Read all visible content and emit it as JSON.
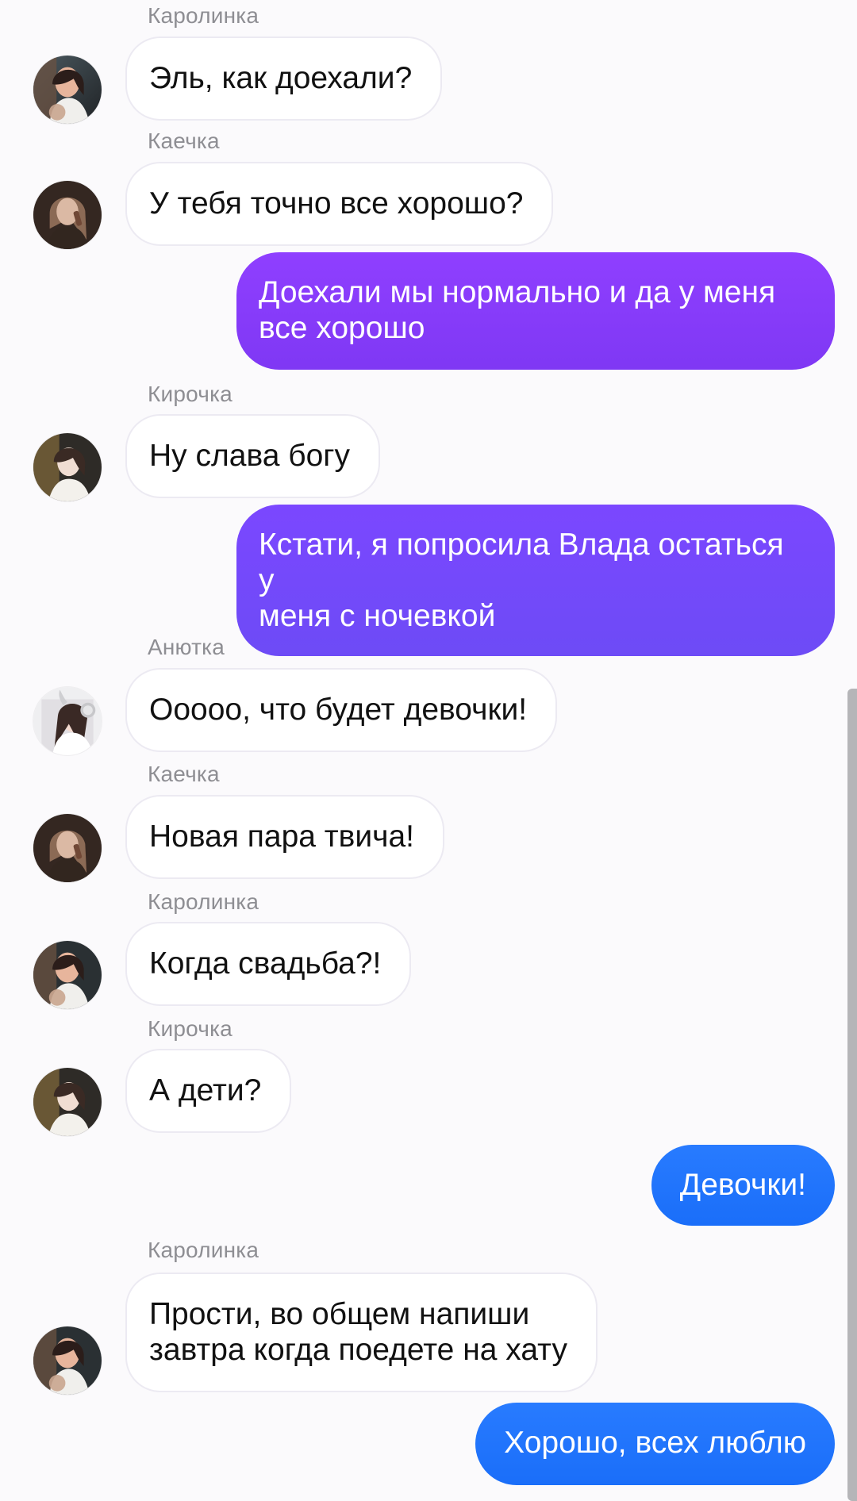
{
  "chat": {
    "messages": [
      {
        "sender": "Каролинка",
        "text": "Эль, как доехали?"
      },
      {
        "sender": "Каечка",
        "text": "У тебя точно все хорошо?"
      },
      {
        "text": "Доехали мы нормально и да у меня\nвсе хорошо",
        "color": "#8a3dff"
      },
      {
        "sender": "Кирочка",
        "text": "Ну слава богу"
      },
      {
        "text": "Кстати, я попросила Влада остаться у\nменя с ночевкой",
        "color": "#744ef8"
      },
      {
        "sender": "Анютка",
        "text": "Ооооо, что будет девочки!"
      },
      {
        "sender": "Каечка",
        "text": "Новая пара твича!"
      },
      {
        "sender": "Каролинка",
        "text": "Когда свадьба?!"
      },
      {
        "sender": "Кирочка",
        "text": "А дети?"
      },
      {
        "text": "Девочки!",
        "color": "#1f73ff"
      },
      {
        "sender": "Каролинка",
        "text": "Прости, во общем напиши\nзавтра когда поедете на хату"
      },
      {
        "text": "Хорошо, всех люблю",
        "color": "#1f73ff"
      }
    ]
  },
  "avatars": {
    "icons": [
      "karolinka-avatar",
      "kaechka-avatar",
      "kirochka-avatar",
      "anyutka-avatar"
    ]
  },
  "scrollbar": {
    "visible": true,
    "color": "#b5b5b8"
  }
}
